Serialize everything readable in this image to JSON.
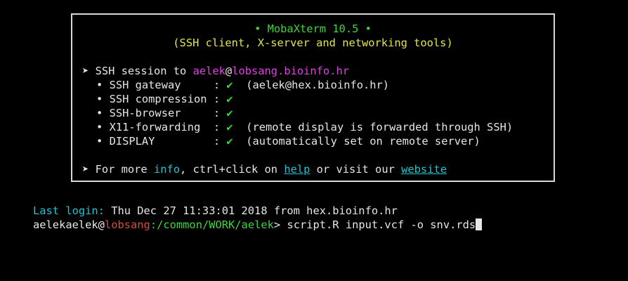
{
  "banner": {
    "title": "• MobaXterm 10.5 •",
    "subtitle": "(SSH client, X-server and networking tools)",
    "session": {
      "bullet": "➤",
      "prefix": "SSH session to ",
      "user": "aelek",
      "at": "@",
      "host": "lobsang.bioinfo.hr"
    },
    "features": [
      {
        "bullet": "•",
        "name": "SSH gateway     ",
        "sep": ":",
        "check": "✔",
        "note": "(aelek@hex.bioinfo.hr)"
      },
      {
        "bullet": "•",
        "name": "SSH compression ",
        "sep": ":",
        "check": "✔",
        "note": ""
      },
      {
        "bullet": "•",
        "name": "SSH-browser     ",
        "sep": ":",
        "check": "✔",
        "note": ""
      },
      {
        "bullet": "•",
        "name": "X11-forwarding  ",
        "sep": ":",
        "check": "✔",
        "note": "(remote display is forwarded through SSH)"
      },
      {
        "bullet": "•",
        "name": "DISPLAY         ",
        "sep": ":",
        "check": "✔",
        "note": "(automatically set on remote server)"
      }
    ],
    "footer": {
      "bullet": "➤",
      "prefix": "For more ",
      "info": "info",
      "mid": ", ctrl+click on ",
      "help": "help",
      "mid2": " or visit our ",
      "website": "website"
    }
  },
  "last_login": {
    "label": "Last login:",
    "value": " Thu Dec 27 11:33:01 2018 from hex.bioinfo.hr"
  },
  "prompt": {
    "user": "aelekaelek",
    "at": "@",
    "host": "lobsang",
    "path": ":/common/WORK/aelek",
    "symbol": "> ",
    "command": "script.R input.vcf -o snv.rds"
  }
}
